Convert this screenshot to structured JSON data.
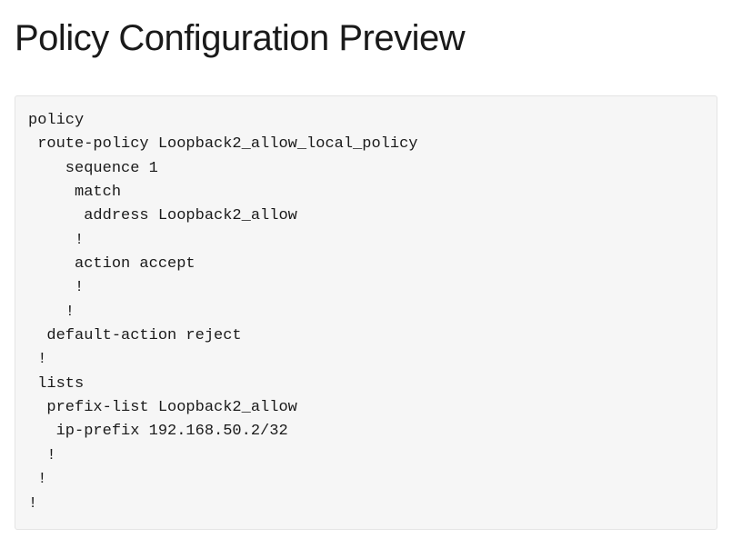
{
  "title": "Policy Configuration Preview",
  "code": "policy\n route-policy Loopback2_allow_local_policy\n    sequence 1\n     match\n      address Loopback2_allow\n     !\n     action accept\n     !\n    !\n  default-action reject\n !\n lists\n  prefix-list Loopback2_allow\n   ip-prefix 192.168.50.2/32\n  !\n !\n!"
}
